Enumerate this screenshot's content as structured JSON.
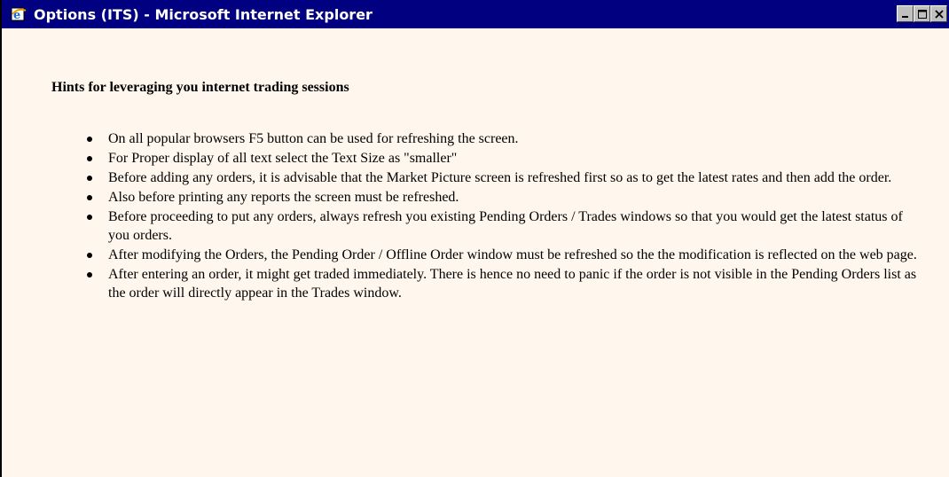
{
  "window": {
    "title": "Options (ITS) - Microsoft Internet Explorer",
    "icon": "internet-explorer-icon",
    "controls": [
      "minimize-icon",
      "maximize-icon",
      "close-icon"
    ]
  },
  "page": {
    "heading": "Hints for leveraging you internet trading sessions",
    "hints": [
      "On all popular browsers F5 button can be used for refreshing the screen.",
      "For Proper display of all text select the Text Size as \"smaller\"",
      "Before adding any orders, it is advisable that the Market Picture screen is refreshed first so as to get the latest rates and then add the order.",
      "Also before printing any reports the screen must be refreshed.",
      "Before proceeding to put any orders, always refresh you existing Pending Orders / Trades windows so that you would get the latest status of you orders.",
      "After modifying the Orders, the Pending Order / Offline Order window must be refreshed so the the modification is reflected on the web page.",
      "After entering an order, it might get traded immediately. There is hence no need to panic if the order is not visible in the Pending Orders list as the order will  directly appear in the Trades window."
    ]
  },
  "colors": {
    "titlebar": "#000080",
    "page_background": "#fff7ee",
    "text": "#000000"
  }
}
